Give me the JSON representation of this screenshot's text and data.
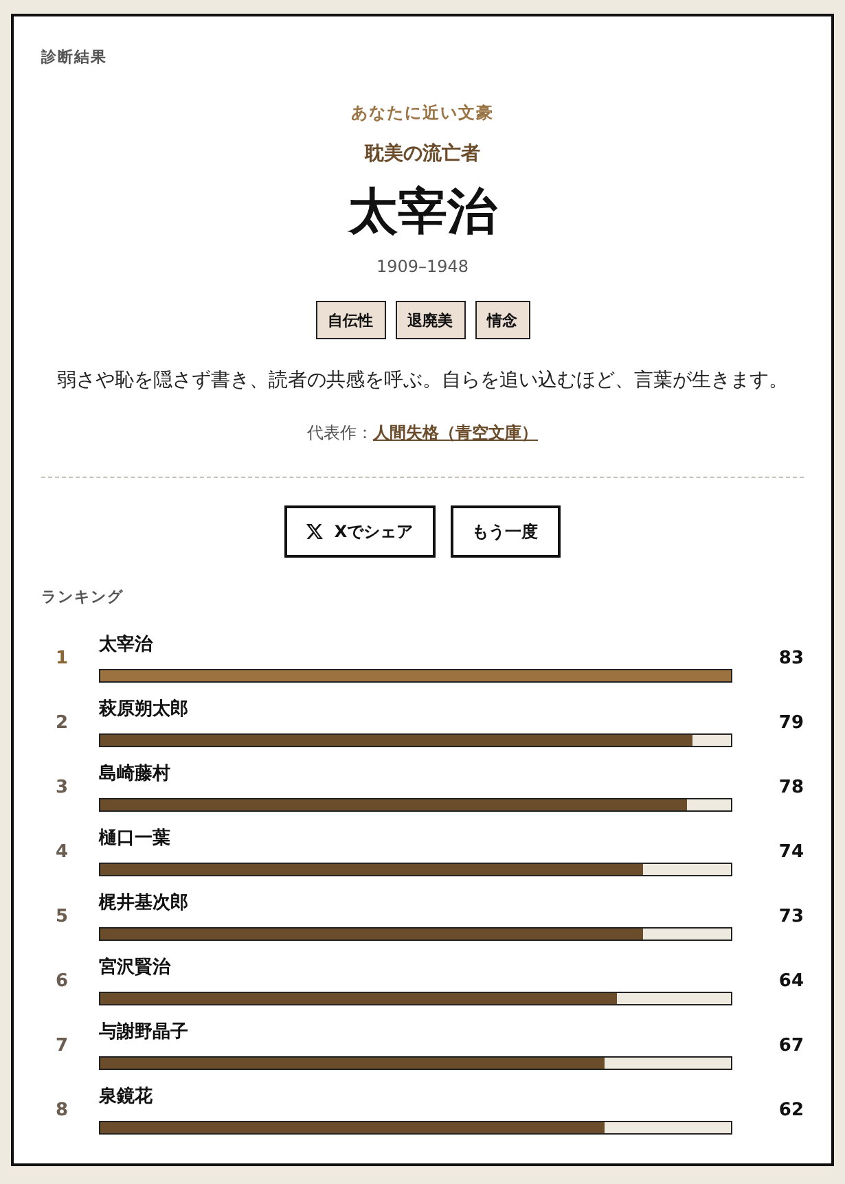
{
  "page": {
    "label": "診断結果"
  },
  "result": {
    "kicker": "あなたに近い文豪",
    "type_name": "耽美の流亡者",
    "author": "太宰治",
    "years": "1909–1948",
    "tags": [
      "自伝性",
      "退廃美",
      "情念"
    ],
    "description": "弱さや恥を隠さず書き、読者の共感を呼ぶ。自らを追い込むほど、言葉が生きます。",
    "work_label": "代表作：",
    "work_link": "人間失格（青空文庫）"
  },
  "actions": [
    {
      "kind": "share",
      "label": "Xでシェア"
    },
    {
      "kind": "retry",
      "label": "もう一度"
    }
  ],
  "ranking": {
    "title": "ランキング",
    "rows": [
      {
        "rank": "1",
        "name": "太宰治",
        "score": "83",
        "level": 1.0,
        "highlighted": true
      },
      {
        "rank": "2",
        "name": "萩原朔太郎",
        "score": "79",
        "level": 0.94,
        "highlighted": false
      },
      {
        "rank": "3",
        "name": "島崎藤村",
        "score": "78",
        "level": 0.93,
        "highlighted": false
      },
      {
        "rank": "4",
        "name": "樋口一葉",
        "score": "74",
        "level": 0.86,
        "highlighted": false
      },
      {
        "rank": "5",
        "name": "梶井基次郎",
        "score": "73",
        "level": 0.86,
        "highlighted": false
      },
      {
        "rank": "6",
        "name": "宮沢賢治",
        "score": "64",
        "level": 0.82,
        "highlighted": false
      },
      {
        "rank": "7",
        "name": "与謝野晶子",
        "score": "67",
        "level": 0.8,
        "highlighted": false
      },
      {
        "rank": "8",
        "name": "泉鏡花",
        "score": "62",
        "level": 0.8,
        "highlighted": false
      }
    ]
  }
}
